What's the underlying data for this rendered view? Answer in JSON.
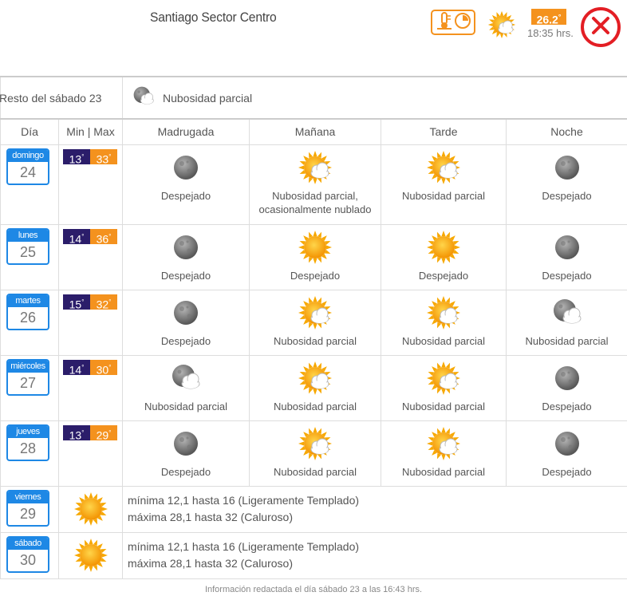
{
  "header": {
    "location": "Santiago Sector Centro",
    "current_temp": "26.2",
    "current_time": "18:35 hrs.",
    "history_icon": "thermometer-clock-icon",
    "current_icon": "partly-cloudy-sun-icon",
    "close_icon": "close-icon"
  },
  "rest": {
    "label": "Resto del sábado 23",
    "condition": "Nubosidad parcial",
    "icon": "moon-cloud-icon"
  },
  "columns": {
    "day": "Día",
    "minmax": "Min | Max",
    "p1": "Madrugada",
    "p2": "Mañana",
    "p3": "Tarde",
    "p4": "Noche"
  },
  "days": [
    {
      "name": "domingo",
      "num": "24",
      "min": "13",
      "max": "33",
      "p1": {
        "icon": "moon",
        "text": "Despejado"
      },
      "p2": {
        "icon": "suncloud",
        "text": "Nubosidad parcial, ocasionalmente nublado"
      },
      "p3": {
        "icon": "suncloud",
        "text": "Nubosidad parcial"
      },
      "p4": {
        "icon": "moon",
        "text": "Despejado"
      }
    },
    {
      "name": "lunes",
      "num": "25",
      "min": "14",
      "max": "36",
      "p1": {
        "icon": "moon",
        "text": "Despejado"
      },
      "p2": {
        "icon": "sun",
        "text": "Despejado"
      },
      "p3": {
        "icon": "sun",
        "text": "Despejado"
      },
      "p4": {
        "icon": "moon",
        "text": "Despejado"
      }
    },
    {
      "name": "martes",
      "num": "26",
      "min": "15",
      "max": "32",
      "p1": {
        "icon": "moon",
        "text": "Despejado"
      },
      "p2": {
        "icon": "suncloud",
        "text": "Nubosidad parcial"
      },
      "p3": {
        "icon": "suncloud",
        "text": "Nubosidad parcial"
      },
      "p4": {
        "icon": "mooncloud",
        "text": "Nubosidad parcial"
      }
    },
    {
      "name": "miércoles",
      "num": "27",
      "min": "14",
      "max": "30",
      "p1": {
        "icon": "mooncloud",
        "text": "Nubosidad parcial"
      },
      "p2": {
        "icon": "suncloud",
        "text": "Nubosidad parcial"
      },
      "p3": {
        "icon": "suncloud",
        "text": "Nubosidad parcial"
      },
      "p4": {
        "icon": "moon",
        "text": "Despejado"
      }
    },
    {
      "name": "jueves",
      "num": "28",
      "min": "13",
      "max": "29",
      "p1": {
        "icon": "moon",
        "text": "Despejado"
      },
      "p2": {
        "icon": "suncloud",
        "text": "Nubosidad parcial"
      },
      "p3": {
        "icon": "suncloud",
        "text": "Nubosidad parcial"
      },
      "p4": {
        "icon": "moon",
        "text": "Despejado"
      }
    }
  ],
  "extended": [
    {
      "name": "viernes",
      "num": "29",
      "icon": "sun",
      "line1": "mínima 12,1 hasta 16 (Ligeramente Templado)",
      "line2": "máxima 28,1 hasta 32 (Caluroso)"
    },
    {
      "name": "sábado",
      "num": "30",
      "icon": "sun",
      "line1": "mínima 12,1 hasta 16 (Ligeramente Templado)",
      "line2": "máxima 28,1 hasta 32 (Caluroso)"
    }
  ],
  "footer": "Información redactada el día sábado 23 a las 16:43 hrs."
}
